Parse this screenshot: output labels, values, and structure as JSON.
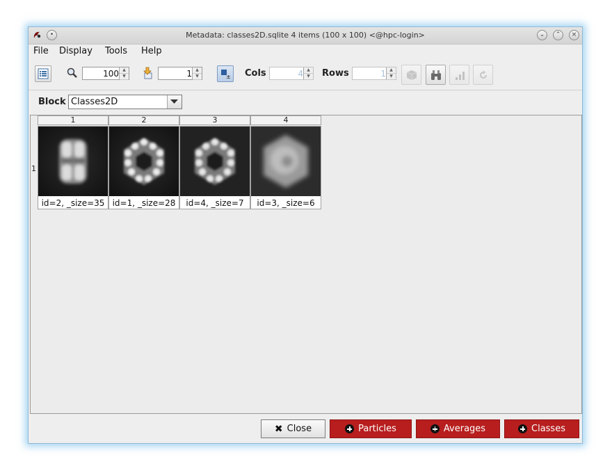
{
  "window": {
    "title": "Metadata: classes2D.sqlite 4 items (100 x 100) <@hpc-login>"
  },
  "menu": [
    "File",
    "Display",
    "Tools",
    "Help"
  ],
  "toolbar": {
    "zoom_value": "100",
    "goto_value": "1",
    "cols_label": "Cols",
    "cols_value": "4",
    "rows_label": "Rows",
    "rows_value": "1"
  },
  "block": {
    "label": "Block",
    "selected": "Classes2D"
  },
  "gallery": {
    "columns": [
      "1",
      "2",
      "3",
      "4"
    ],
    "row_label": "1",
    "items": [
      {
        "caption": "id=2, _size=35",
        "shape": "side-view"
      },
      {
        "caption": "id=1, _size=28",
        "shape": "hexagon-ring"
      },
      {
        "caption": "id=4, _size=7",
        "shape": "hexagon-ring"
      },
      {
        "caption": "id=3, _size=6",
        "shape": "diffuse-hexagon"
      }
    ]
  },
  "buttons": {
    "close": "Close",
    "particles": "Particles",
    "averages": "Averages",
    "classes": "Classes"
  },
  "colors": {
    "accent_red": "#b81e1e",
    "window_glow": "#78bee b"
  }
}
